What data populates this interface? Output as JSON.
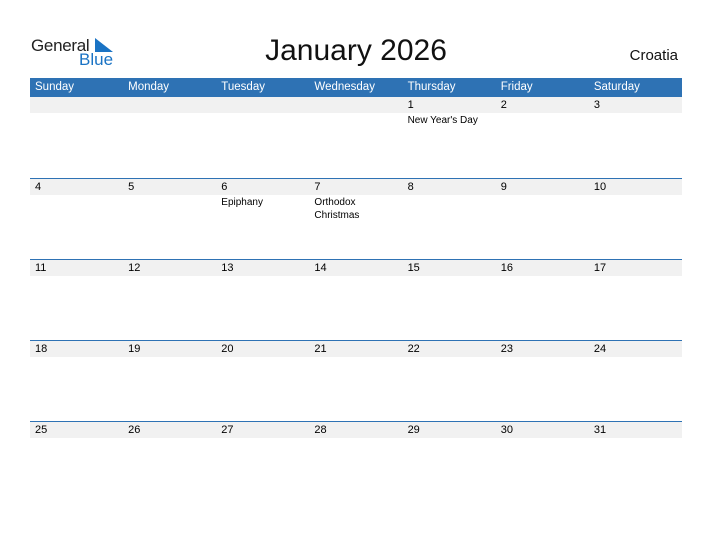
{
  "logo": {
    "general": "General",
    "blue": "Blue"
  },
  "title": "January 2026",
  "country": "Croatia",
  "weekdays": [
    "Sunday",
    "Monday",
    "Tuesday",
    "Wednesday",
    "Thursday",
    "Friday",
    "Saturday"
  ],
  "weeks": [
    [
      {
        "d": "",
        "e": ""
      },
      {
        "d": "",
        "e": ""
      },
      {
        "d": "",
        "e": ""
      },
      {
        "d": "",
        "e": ""
      },
      {
        "d": "1",
        "e": "New Year's Day"
      },
      {
        "d": "2",
        "e": ""
      },
      {
        "d": "3",
        "e": ""
      }
    ],
    [
      {
        "d": "4",
        "e": ""
      },
      {
        "d": "5",
        "e": ""
      },
      {
        "d": "6",
        "e": "Epiphany"
      },
      {
        "d": "7",
        "e": "Orthodox Christmas"
      },
      {
        "d": "8",
        "e": ""
      },
      {
        "d": "9",
        "e": ""
      },
      {
        "d": "10",
        "e": ""
      }
    ],
    [
      {
        "d": "11",
        "e": ""
      },
      {
        "d": "12",
        "e": ""
      },
      {
        "d": "13",
        "e": ""
      },
      {
        "d": "14",
        "e": ""
      },
      {
        "d": "15",
        "e": ""
      },
      {
        "d": "16",
        "e": ""
      },
      {
        "d": "17",
        "e": ""
      }
    ],
    [
      {
        "d": "18",
        "e": ""
      },
      {
        "d": "19",
        "e": ""
      },
      {
        "d": "20",
        "e": ""
      },
      {
        "d": "21",
        "e": ""
      },
      {
        "d": "22",
        "e": ""
      },
      {
        "d": "23",
        "e": ""
      },
      {
        "d": "24",
        "e": ""
      }
    ],
    [
      {
        "d": "25",
        "e": ""
      },
      {
        "d": "26",
        "e": ""
      },
      {
        "d": "27",
        "e": ""
      },
      {
        "d": "28",
        "e": ""
      },
      {
        "d": "29",
        "e": ""
      },
      {
        "d": "30",
        "e": ""
      },
      {
        "d": "31",
        "e": ""
      }
    ]
  ]
}
